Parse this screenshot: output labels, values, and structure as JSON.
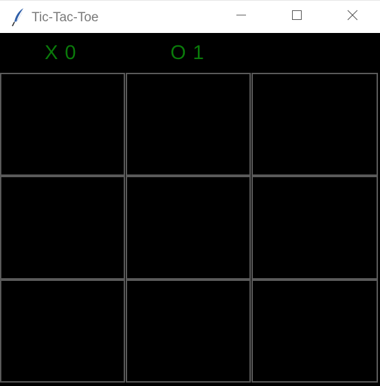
{
  "window": {
    "title": "Tic-Tac-Toe",
    "app_icon": "feather-icon",
    "controls": {
      "minimize": "minimize-icon",
      "maximize": "maximize-icon",
      "close": "close-icon"
    }
  },
  "scoreboard": {
    "x_label": "X 0",
    "o_label": "O 1",
    "color": "#0a7a0a"
  },
  "board": {
    "rows": 3,
    "cols": 3,
    "cells": [
      "",
      "",
      "",
      "",
      "",
      "",
      "",
      "",
      ""
    ],
    "cell_border_color": "#5a5a5a",
    "background": "#000000"
  }
}
